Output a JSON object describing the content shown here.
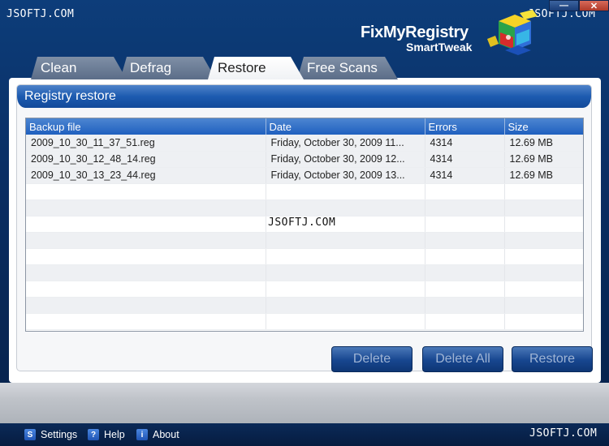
{
  "watermark": "JSOFTJ.COM",
  "window_controls": {
    "minimize": "—",
    "close": "✕"
  },
  "logo": {
    "line1": "FixMyRegistry",
    "line2": "SmartTweak"
  },
  "tabs": [
    {
      "label": "Clean",
      "active": false
    },
    {
      "label": "Defrag",
      "active": false
    },
    {
      "label": "Restore",
      "active": true
    },
    {
      "label": "Free Scans",
      "active": false
    }
  ],
  "group": {
    "title": "Registry restore"
  },
  "table": {
    "columns": [
      "Backup file",
      "Date",
      "Errors",
      "Size"
    ],
    "rows": [
      [
        "2009_10_30_11_37_51.reg",
        "Friday, October 30, 2009 11...",
        "4314",
        "12.69 MB"
      ],
      [
        "2009_10_30_12_48_14.reg",
        "Friday, October 30, 2009 12...",
        "4314",
        "12.69 MB"
      ],
      [
        "2009_10_30_13_23_44.reg",
        "Friday, October 30, 2009 13...",
        "4314",
        "12.69 MB"
      ]
    ]
  },
  "buttons": {
    "delete": "Delete",
    "delete_all": "Delete All",
    "restore": "Restore"
  },
  "footer": {
    "settings": "Settings",
    "settings_icon": "S",
    "help": "Help",
    "help_icon": "?",
    "about": "About",
    "about_icon": "i"
  },
  "colors": {
    "header_blue": "#1d5bb0",
    "button_blue": "#17468f",
    "app_bg": "#0d3d7a"
  }
}
